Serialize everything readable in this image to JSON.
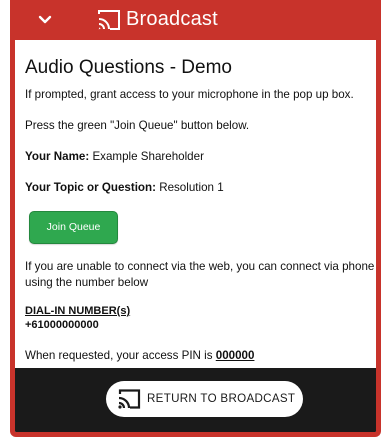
{
  "header": {
    "title": "Broadcast",
    "collapse_icon": "chevron-down-icon",
    "cast_icon": "cast-icon",
    "background_color": "#c8332b"
  },
  "main": {
    "title": "Audio Questions - Demo",
    "instruction_1": "If prompted, grant access to your microphone in the pop up box.",
    "instruction_2": "Press the green \"Join Queue\" button below.",
    "name_label": "Your Name:",
    "name_value": " Example Shareholder",
    "topic_label": "Your Topic or Question:",
    "topic_value": " Resolution 1",
    "join_button_label": "Join Queue",
    "join_button_color": "#2fa84f",
    "phone_instruction": "If you are unable to connect via the web, you can connect via phone using the number below",
    "dial_in_label": "DIAL-IN NUMBER(s)",
    "dial_in_number": "+61000000000",
    "pin_text": "When requested, your access PIN is ",
    "pin_value": "000000"
  },
  "footer": {
    "return_button_label": "RETURN TO BROADCAST",
    "return_icon": "cast-icon",
    "background_color": "#1a1a1a"
  }
}
